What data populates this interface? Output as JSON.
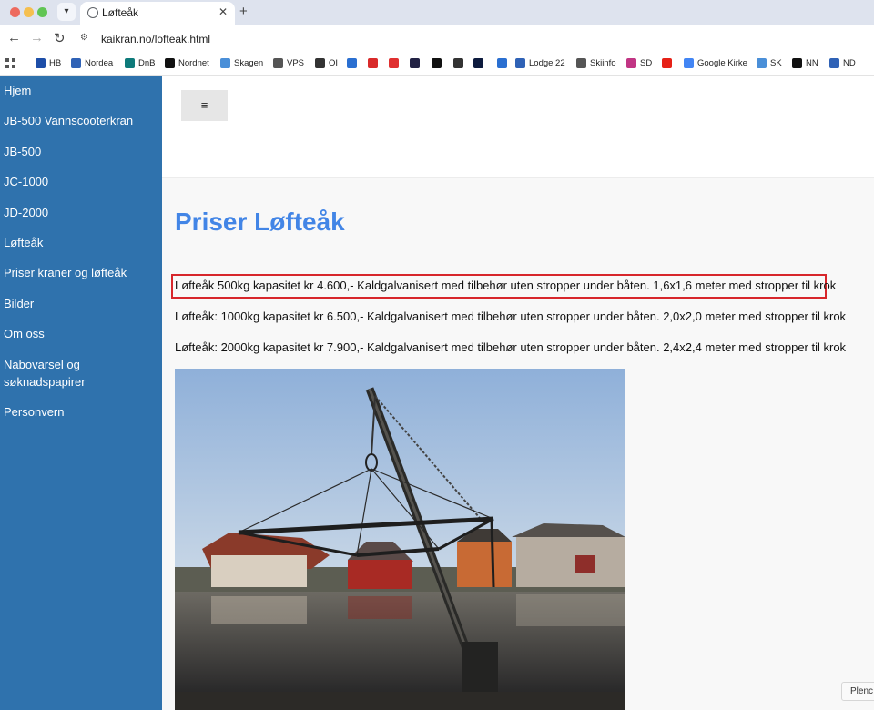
{
  "browser": {
    "tab_title": "Løfteåk",
    "url": "kaikran.no/lofteak.html",
    "bookmarks": [
      {
        "label": "HB",
        "color": "#1d4ea8"
      },
      {
        "label": "Nordea",
        "color": "#2f62b6"
      },
      {
        "label": "DnB",
        "color": "#0e7a7a"
      },
      {
        "label": "Nordnet",
        "color": "#111111"
      },
      {
        "label": "Skagen",
        "color": "#4a8fd8"
      },
      {
        "label": "VPS",
        "color": "#555555"
      },
      {
        "label": "OI",
        "color": "#333333"
      },
      {
        "label": "",
        "color": "#2a6fd1"
      },
      {
        "label": "",
        "color": "#d92a2a"
      },
      {
        "label": "",
        "color": "#e03030"
      },
      {
        "label": "",
        "color": "#222244"
      },
      {
        "label": "",
        "color": "#111111"
      },
      {
        "label": "",
        "color": "#333333"
      },
      {
        "label": "",
        "color": "#0d1b3e"
      },
      {
        "label": "",
        "color": "#2a6fd1"
      },
      {
        "label": "Lodge 22",
        "color": "#2f62b6"
      },
      {
        "label": "Skiinfo",
        "color": "#555555"
      },
      {
        "label": "SD",
        "color": "#c13584"
      },
      {
        "label": "",
        "color": "#e62117"
      },
      {
        "label": "Google Kirke",
        "color": "#4285f4"
      },
      {
        "label": "SK",
        "color": "#4a8fd8"
      },
      {
        "label": "NN",
        "color": "#111111"
      },
      {
        "label": "ND",
        "color": "#2f62b6"
      }
    ]
  },
  "sidebar": {
    "items": [
      {
        "label": "Hjem"
      },
      {
        "label": "JB-500 Vannscooterkran"
      },
      {
        "label": "JB-500"
      },
      {
        "label": "JC-1000"
      },
      {
        "label": "JD-2000"
      },
      {
        "label": "Løfteåk"
      },
      {
        "label": "Priser kraner og løfteåk"
      },
      {
        "label": "Bilder"
      },
      {
        "label": "Om oss"
      },
      {
        "label": "Nabovarsel og søknadspapirer"
      },
      {
        "label": "Personvern"
      }
    ]
  },
  "header": {
    "menu_icon": "≡"
  },
  "main": {
    "title": "Priser Løfteåk",
    "price_lines": [
      "Løfteåk 500kg kapasitet kr 4.600,- Kaldgalvanisert med tilbehør uten stropper under båten. 1,6x1,6 meter med stropper til krok",
      "Løfteåk: 1000kg kapasitet kr 6.500,- Kaldgalvanisert med tilbehør uten stropper under båten. 2,0x2,0 meter med stropper til krok",
      "Løfteåk: 2000kg kapasitet kr 7.900,- Kaldgalvanisert med tilbehør uten stropper under båten. 2,4x2,4 meter med stropper til krok"
    ],
    "highlight_color": "#d7262b"
  },
  "floating_button": {
    "label": "Plenc"
  },
  "colors": {
    "sidebar": "#2f72ad",
    "title": "#4285e6"
  }
}
